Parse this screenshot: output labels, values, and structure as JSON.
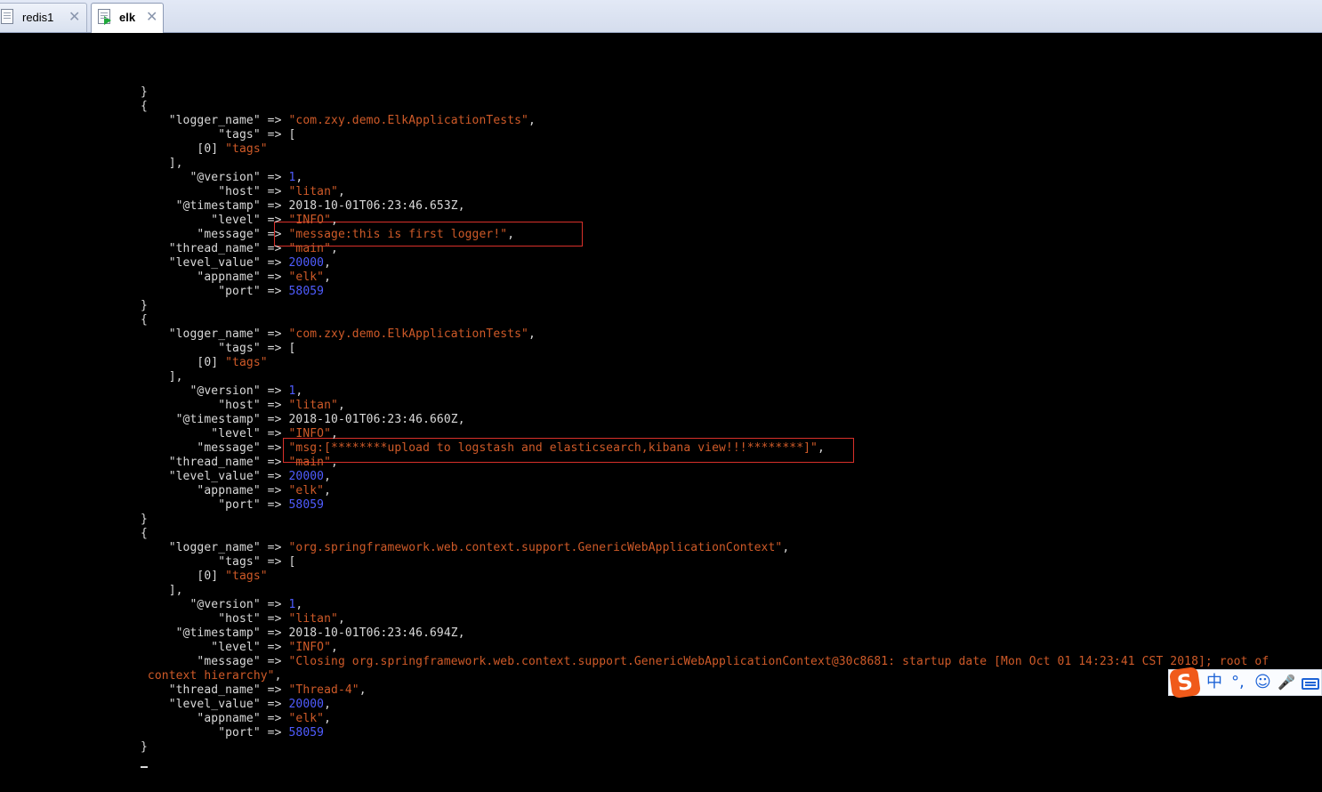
{
  "tabs": [
    {
      "label": "redis1",
      "close": "✕",
      "active": false
    },
    {
      "label": "elk",
      "close": "✕",
      "active": true
    }
  ],
  "terminal": {
    "lines": [
      [
        [
          "w",
          "}"
        ]
      ],
      [
        [
          "w",
          "{"
        ]
      ],
      [
        [
          "w",
          "    \"logger_name\" => "
        ],
        [
          "s",
          "\"com.zxy.demo.ElkApplicationTests\""
        ],
        [
          "w",
          ","
        ]
      ],
      [
        [
          "w",
          "           \"tags\" => ["
        ]
      ],
      [
        [
          "w",
          "        [0] "
        ],
        [
          "s",
          "\"tags\""
        ]
      ],
      [
        [
          "w",
          "    ],"
        ]
      ],
      [
        [
          "w",
          "       \"@version\" => "
        ],
        [
          "n",
          "1"
        ],
        [
          "w",
          ","
        ]
      ],
      [
        [
          "w",
          "           \"host\" => "
        ],
        [
          "s",
          "\"litan\""
        ],
        [
          "w",
          ","
        ]
      ],
      [
        [
          "w",
          "     \"@timestamp\" => 2018-10-01T06:23:46.653Z,"
        ]
      ],
      [
        [
          "w",
          "          \"level\" => "
        ],
        [
          "s",
          "\"INFO\""
        ],
        [
          "w",
          ","
        ]
      ],
      [
        [
          "w",
          "        \"message\" => "
        ],
        [
          "s",
          "\"message:this is first logger!\""
        ],
        [
          "w",
          ","
        ]
      ],
      [
        [
          "w",
          "    \"thread_name\" => "
        ],
        [
          "s",
          "\"main\""
        ],
        [
          "w",
          ","
        ]
      ],
      [
        [
          "w",
          "    \"level_value\" => "
        ],
        [
          "n",
          "20000"
        ],
        [
          "w",
          ","
        ]
      ],
      [
        [
          "w",
          "        \"appname\" => "
        ],
        [
          "s",
          "\"elk\""
        ],
        [
          "w",
          ","
        ]
      ],
      [
        [
          "w",
          "           \"port\" => "
        ],
        [
          "n",
          "58059"
        ]
      ],
      [
        [
          "w",
          "}"
        ]
      ],
      [
        [
          "w",
          "{"
        ]
      ],
      [
        [
          "w",
          "    \"logger_name\" => "
        ],
        [
          "s",
          "\"com.zxy.demo.ElkApplicationTests\""
        ],
        [
          "w",
          ","
        ]
      ],
      [
        [
          "w",
          "           \"tags\" => ["
        ]
      ],
      [
        [
          "w",
          "        [0] "
        ],
        [
          "s",
          "\"tags\""
        ]
      ],
      [
        [
          "w",
          "    ],"
        ]
      ],
      [
        [
          "w",
          "       \"@version\" => "
        ],
        [
          "n",
          "1"
        ],
        [
          "w",
          ","
        ]
      ],
      [
        [
          "w",
          "           \"host\" => "
        ],
        [
          "s",
          "\"litan\""
        ],
        [
          "w",
          ","
        ]
      ],
      [
        [
          "w",
          "     \"@timestamp\" => 2018-10-01T06:23:46.660Z,"
        ]
      ],
      [
        [
          "w",
          "          \"level\" => "
        ],
        [
          "s",
          "\"INFO\""
        ],
        [
          "w",
          ","
        ]
      ],
      [
        [
          "w",
          "        \"message\" => "
        ],
        [
          "s",
          "\"msg:[********upload to logstash and elasticsearch,kibana view!!!********]\""
        ],
        [
          "w",
          ","
        ]
      ],
      [
        [
          "w",
          "    \"thread_name\" => "
        ],
        [
          "s",
          "\"main\""
        ],
        [
          "w",
          ","
        ]
      ],
      [
        [
          "w",
          "    \"level_value\" => "
        ],
        [
          "n",
          "20000"
        ],
        [
          "w",
          ","
        ]
      ],
      [
        [
          "w",
          "        \"appname\" => "
        ],
        [
          "s",
          "\"elk\""
        ],
        [
          "w",
          ","
        ]
      ],
      [
        [
          "w",
          "           \"port\" => "
        ],
        [
          "n",
          "58059"
        ]
      ],
      [
        [
          "w",
          "}"
        ]
      ],
      [
        [
          "w",
          "{"
        ]
      ],
      [
        [
          "w",
          "    \"logger_name\" => "
        ],
        [
          "s",
          "\"org.springframework.web.context.support.GenericWebApplicationContext\""
        ],
        [
          "w",
          ","
        ]
      ],
      [
        [
          "w",
          "           \"tags\" => ["
        ]
      ],
      [
        [
          "w",
          "        [0] "
        ],
        [
          "s",
          "\"tags\""
        ]
      ],
      [
        [
          "w",
          "    ],"
        ]
      ],
      [
        [
          "w",
          "       \"@version\" => "
        ],
        [
          "n",
          "1"
        ],
        [
          "w",
          ","
        ]
      ],
      [
        [
          "w",
          "           \"host\" => "
        ],
        [
          "s",
          "\"litan\""
        ],
        [
          "w",
          ","
        ]
      ],
      [
        [
          "w",
          "     \"@timestamp\" => 2018-10-01T06:23:46.694Z,"
        ]
      ],
      [
        [
          "w",
          "          \"level\" => "
        ],
        [
          "s",
          "\"INFO\""
        ],
        [
          "w",
          ","
        ]
      ],
      [
        [
          "w",
          "        \"message\" => "
        ],
        [
          "s",
          "\"Closing org.springframework.web.context.support.GenericWebApplicationContext@30c8681: startup date [Mon Oct 01 14:23:41 CST 2018]; root of"
        ]
      ],
      [
        [
          "s",
          " context hierarchy\""
        ],
        [
          "w",
          ","
        ]
      ],
      [
        [
          "w",
          "    \"thread_name\" => "
        ],
        [
          "s",
          "\"Thread-4\""
        ],
        [
          "w",
          ","
        ]
      ],
      [
        [
          "w",
          "    \"level_value\" => "
        ],
        [
          "n",
          "20000"
        ],
        [
          "w",
          ","
        ]
      ],
      [
        [
          "w",
          "        \"appname\" => "
        ],
        [
          "s",
          "\"elk\""
        ],
        [
          "w",
          ","
        ]
      ],
      [
        [
          "w",
          "           \"port\" => "
        ],
        [
          "n",
          "58059"
        ]
      ],
      [
        [
          "w",
          "}"
        ]
      ]
    ]
  },
  "ime": {
    "logo": "S",
    "items": [
      "中",
      "°,",
      "☺",
      "🎤"
    ]
  }
}
